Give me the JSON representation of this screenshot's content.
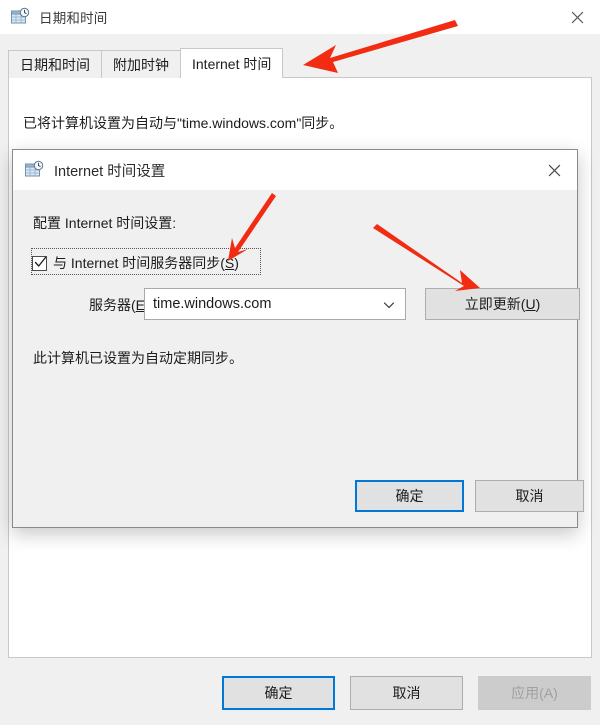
{
  "colors": {
    "accent": "#0078d7",
    "annotation_arrow": "#f22b13",
    "window_bg": "#f0f0f0",
    "page_bg": "#ffffff",
    "button_bg": "#e1e1e1",
    "disabled_text": "#a0a0a0"
  },
  "outer_window": {
    "title": "日期和时间",
    "icon": "date-time-icon",
    "close_icon": "close-icon",
    "tabs": [
      {
        "label": "日期和时间",
        "active": false
      },
      {
        "label": "附加时钟",
        "active": false
      },
      {
        "label": "Internet 时间",
        "active": true
      }
    ],
    "sync_status_text": "已将计算机设置为自动与\"time.windows.com\"同步。",
    "buttons": [
      {
        "label": "确定",
        "state": "default"
      },
      {
        "label": "取消",
        "state": "normal"
      },
      {
        "label": "应用(A)",
        "state": "disabled"
      }
    ]
  },
  "inner_dialog": {
    "title": "Internet 时间设置",
    "icon": "date-time-icon",
    "close_icon": "close-icon",
    "configure_label": "配置 Internet 时间设置:",
    "sync_checkbox": {
      "label_prefix": "与 Internet 时间服务器同步(",
      "accelerator": "S",
      "label_suffix": ")",
      "checked": true,
      "focused": true
    },
    "server_field": {
      "label_prefix": "服务器(",
      "label_accelerator": "E",
      "label_suffix": "):",
      "value": "time.windows.com",
      "placeholder": "time.windows.com",
      "dropdown_icon": "chevron-down-icon"
    },
    "update_button": {
      "label_prefix": "立即更新(",
      "accelerator": "U",
      "label_suffix": ")"
    },
    "periodic_status_text": "此计算机已设置为自动定期同步。",
    "buttons": [
      {
        "label": "确定",
        "state": "default"
      },
      {
        "label": "取消",
        "state": "normal"
      }
    ]
  },
  "annotations": [
    {
      "name": "arrow-to-internet-time-tab",
      "target": "Internet 时间 tab"
    },
    {
      "name": "arrow-to-sync-checkbox",
      "target": "与 Internet 时间服务器同步(S) checkbox"
    },
    {
      "name": "arrow-to-update-now-button",
      "target": "立即更新(U) button"
    }
  ]
}
